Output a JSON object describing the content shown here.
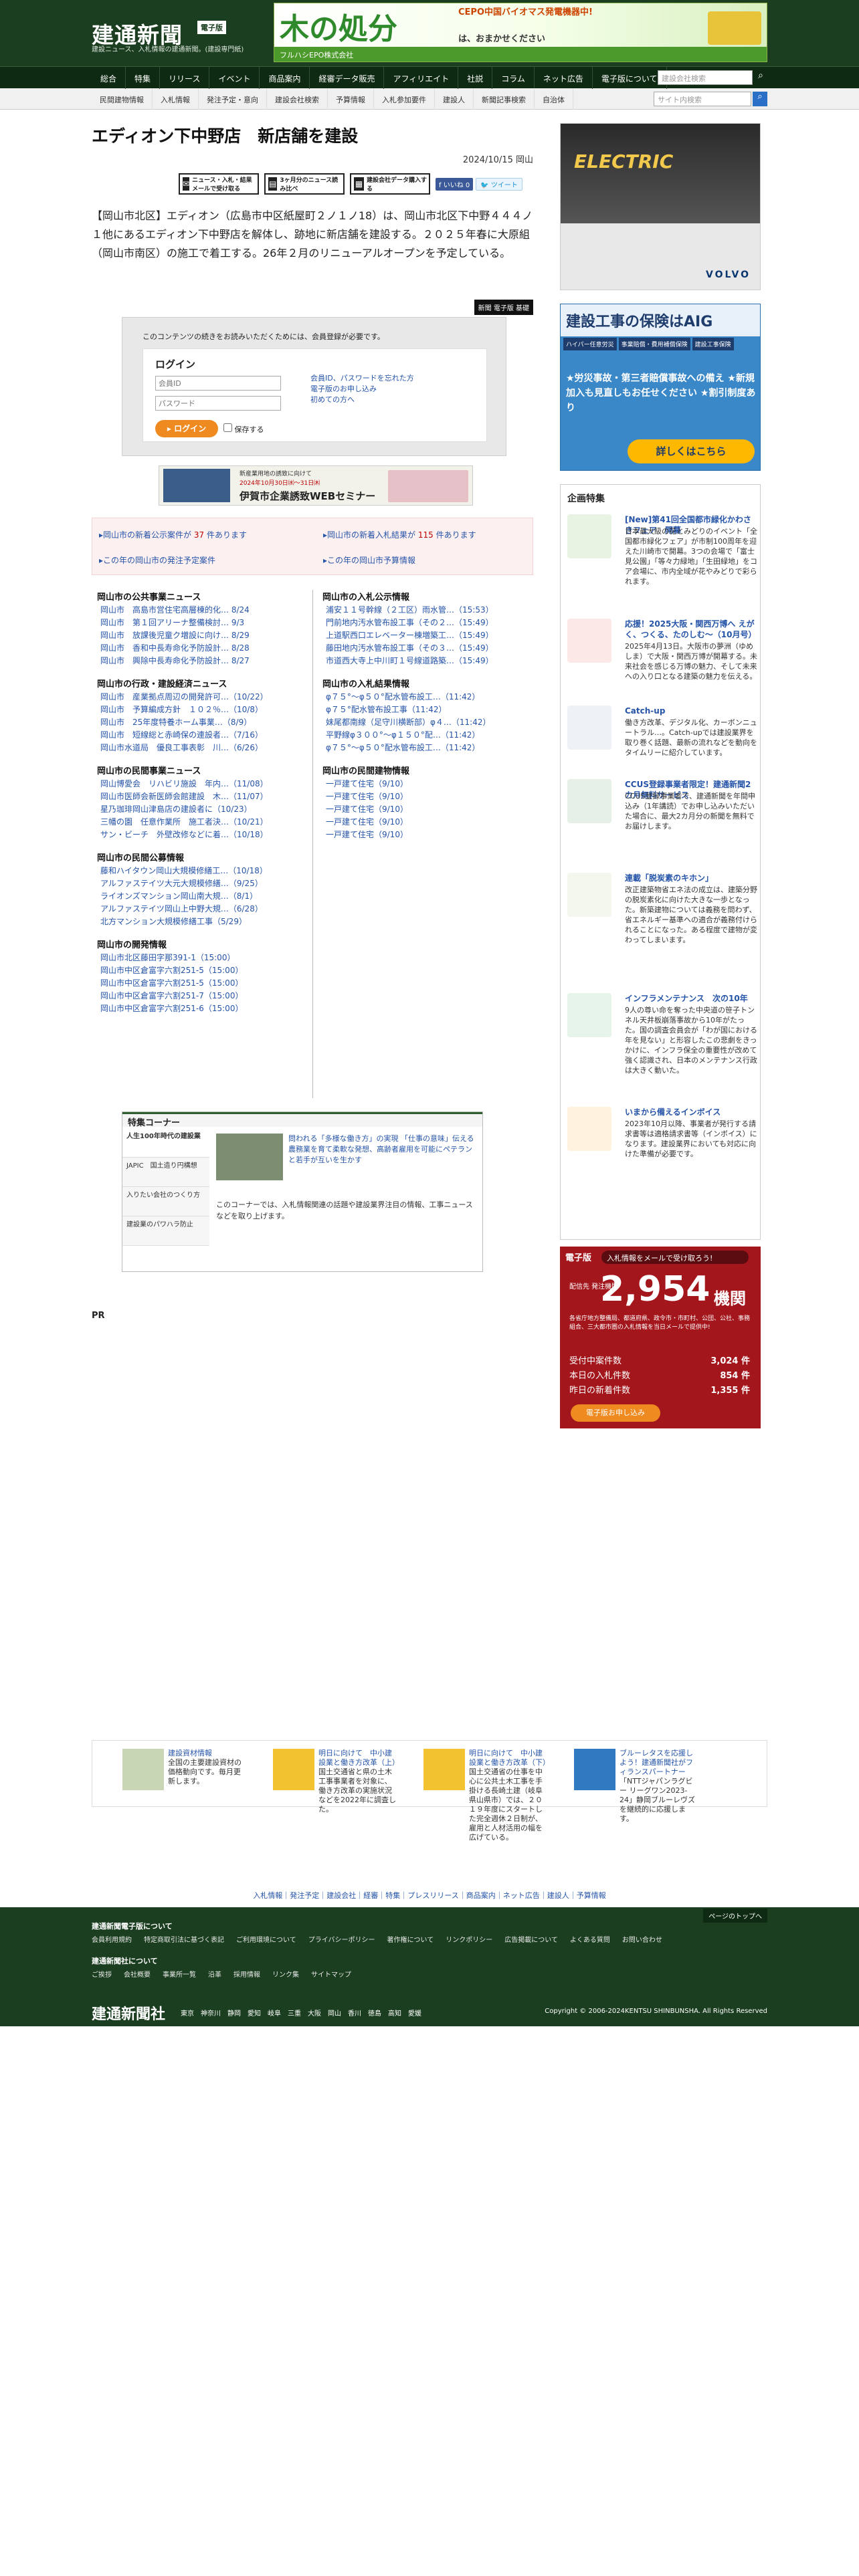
{
  "header": {
    "logo": "建通新聞",
    "edition": "電子版",
    "tagline": "建設ニュース、入札情報の建通新聞。(建設専門紙)",
    "banner_big": "木の処分",
    "banner_small": "CEPO中国バイオマス発電機器中!",
    "banner_sub": "は、おまかせください",
    "banner_foot": "フルハシEPO株式会社"
  },
  "nav1": {
    "items": [
      "総合",
      "特集",
      "リリース",
      "イベント",
      "商品案内",
      "経審データ販売",
      "アフィリエイト",
      "社説",
      "コラム",
      "ネット広告",
      "電子版について"
    ],
    "search_placeholder": "建設会社検索"
  },
  "nav2": {
    "items": [
      "民間建物情報",
      "入札情報",
      "発注予定・意向",
      "建設会社検索",
      "予算情報",
      "入札参加要件",
      "建設人",
      "新聞記事検索",
      "自治体"
    ],
    "search_placeholder": "サイト内検索"
  },
  "article": {
    "title": "エディオン下中野店　新店舗を建設",
    "date": "2024/10/15",
    "region": "岡山",
    "tools": [
      "ニュース・入札・結果メールで受け取る",
      "3ヶ月分のニュース読み比べ",
      "建設会社データ購入する"
    ],
    "like_label": "いいね",
    "like_count": "0",
    "tweet_label": "ツイート",
    "body": "【岡山市北区】エディオン（広島市中区紙屋町２ノ１ノ18）は、岡山市北区下中野４４４ノ１他にあるエディオン下中野店を解体し、跡地に新店舗を建設する。２０２５年春に大原組（岡山市南区）の施工で着工する。26年２月のリニューアルオープンを予定している。",
    "badge": "新聞 電子版 基礎"
  },
  "login": {
    "note": "このコンテンツの続きをお読みいただくためには、会員登録が必要です。",
    "heading": "ログイン",
    "id_placeholder": "会員ID",
    "pw_placeholder": "パスワード",
    "links": [
      "会員ID、パスワードを忘れた方",
      "電子版のお申し込み",
      "初めての方へ"
    ],
    "login_button": "ログイン",
    "keep_label": "保存する"
  },
  "seminar": {
    "line1": "新産業用地の誘致に向けて",
    "line2": "2024年10月30日㈬～31日㈭",
    "line3": "伊賀市企業誘致WEBセミナー"
  },
  "pink": {
    "c1_prefix": "岡山市の新着公示案件が ",
    "c1_count": "37",
    "c1_suffix": " 件あります",
    "c2_prefix": "岡山市の新着入札結果が ",
    "c2_count": "115",
    "c2_suffix": " 件あります",
    "c3": "この年の岡山市の発注予定案件",
    "c4": "この年の岡山市予算情報"
  },
  "sections_left": [
    {
      "title": "岡山市の公共事業ニュース",
      "items": [
        "岡山市　高島市営住宅高層棟的化…  8/24",
        "岡山市　第１回アリーナ整備検討…  9/3",
        "岡山市　放課後児童ク増設に向け…  8/29",
        "岡山市　香和中長寿命化予防設計…  8/28",
        "岡山市　興除中長寿命化予防設計…  8/27"
      ]
    },
    {
      "title": "岡山市の行政・建設経済ニュース",
      "items": [
        "岡山市　産業拠点周辺の開発許可…（10/22）",
        "岡山市　予算編成方針　１０２％…（10/8）",
        "岡山市　25年度特養ホーム事業…（8/9）",
        "岡山市　短線総と赤崎保の連設者…（7/16）",
        "岡山市水道局　優良工事表彰　川…（6/26）"
      ]
    },
    {
      "title": "岡山市の民間事業ニュース",
      "items": [
        "岡山博愛会　リハビリ施設　年内…（11/08）",
        "岡山市医師会新医師会館建設　木…（11/07）",
        "星乃珈琲岡山津島店の建設者に（10/23）",
        "三幡の園　任意作業所　施工者決…（10/21）",
        "サン・ビーチ　外壁改修などに着…（10/18）"
      ]
    },
    {
      "title": "岡山市の民間公募情報",
      "items": [
        "藤和ハイタウン岡山大規模修繕工…（10/18）",
        "アルファステイツ大元大規模修繕…（9/25）",
        "ライオンズマンション岡山南大規…（8/1）",
        "アルファステイツ岡山上中野大規…（6/28）",
        "北方マンション大規模修繕工事（5/29）"
      ]
    },
    {
      "title": "岡山市の開発情報",
      "items": [
        "岡山市北区藤田字那391-1（15:00）",
        "岡山市中区倉富字六割251-5（15:00）",
        "岡山市中区倉富字六割251-5（15:00）",
        "岡山市中区倉富字六割251-7（15:00）",
        "岡山市中区倉富字六割251-6（15:00）"
      ]
    }
  ],
  "sections_right": [
    {
      "title": "岡山市の入札公示情報",
      "items": [
        "浦安１１号幹線（２工区）雨水管…（15:53）",
        "門前地内汚水管布設工事（その２…（15:49）",
        "上道駅西口エレベーター棟増築工…（15:49）",
        "藤田地内汚水管布設工事（その３…（15:49）",
        "市道西大寺上中川町１号線道路築…（15:49）"
      ]
    },
    {
      "title": "岡山市の入札結果情報",
      "items": [
        "φ７５°～φ５０°配水管布設工…（11:42）",
        "φ７５°配水管布設工事（11:42）",
        "妹尾都南線（足守川横断部）φ４…（11:42）",
        "平野線φ３００°～φ１５０°配…（11:42）",
        "φ７５°～φ５０°配水管布設工…（11:42）"
      ]
    },
    {
      "title": "岡山市の民間建物情報",
      "items": [
        "一戸建て住宅（9/10）",
        "一戸建て住宅（9/10）",
        "一戸建て住宅（9/10）",
        "一戸建て住宅（9/10）",
        "一戸建て住宅（9/10）"
      ]
    }
  ],
  "feature": {
    "heading": "特集コーナー",
    "menu": [
      "人生100年時代の建設業",
      "JAPIC　国土造り円構想",
      "入りたい会社のつくり方",
      "建設業のパワハラ防止"
    ],
    "pic_text": "問われる「多様な働き方」の実現 「仕事の意味」伝える農務業を育て柔軟な発想、高齢者雇用を可能にペテランと若手が互いを生かす",
    "desc": "このコーナーでは、入札情報関連の話題や建設業界注目の情報、工事ニュースなどを取り上げます。"
  },
  "pr_label": "PR",
  "side": {
    "ad1_text": "ELECTRIC",
    "ad1_brand": "VOLVO",
    "ad2_top": "建設工事の保険はAIG",
    "ad2_tabs": [
      "ハイパー任意労災",
      "事業賠償・費用補償保険",
      "建設工事保険"
    ],
    "ad2_mid": "★労災事故・第三者賠償事故への備え ★新規加入も見直しもお任せください ★割引制度あり",
    "ad2_btn": "詳しくはこちら",
    "kikaku_heading": "企画特集",
    "kikaku": [
      {
        "title": "[New]第41回全国都市緑化かわさきフェア　開幕",
        "desc": "日本最大級の花とみどりのイベント「全国都市緑化フェア」が市制100周年を迎えた川崎市で開幕。3つの会場で「富士見公園」「等々力緑地」「生田緑地」をコア会場に、市内全域が花やみどりで彩られます。"
      },
      {
        "title": "応援！2025大阪・関西万博へ えがく、つくる、たのしむ～（10月号）",
        "desc": "2025年4月13日。大阪市の夢洲（ゆめしま）で大阪・関西万博が開幕する。未来社会を感じる万博の魅力、そして未来への入り口となる建築の魅力を伝える。"
      },
      {
        "title": "Catch-up",
        "desc": "働き方改革、デジタル化、カーボンニュートラル…。Catch-upでは建設業界を取り巻く話題、最新の流れなどを動向をタイムリーに紹介しています。"
      },
      {
        "title": "CCUS登録事業者限定！建通新聞2カ月無料サービス",
        "desc": "CCUS登録事業者で、建通新聞を年間申込み（1年講読）でお申し込みいただいた場合に、最大2カ月分の新聞を無料でお届けします。"
      },
      {
        "title": "連載「脱炭素のキホン」",
        "desc": "改正建築物省エネ法の成立は、建築分野の脱炭素化に向けた大きな一歩となった。新築建物については義務を問わず、省エネルギー基準への適合が義務付けられることになった。ある程度で建物が変わってしまいます。"
      },
      {
        "title": "インフラメンテナンス　次の10年",
        "desc": "9人の尊い命を奪った中央道の笹子トンネル天井板崩落事故から10年がたった。国の調査会員会が「わが国における年を見ない」と形容したこの悲劇をきっかけに、インフラ保全の重要性が改めて強く認識され、日本のメンテナンス行政は大きく動いた。"
      },
      {
        "title": "いまから備えるインボイス",
        "desc": "2023年10月以降、事業者が発行する請求書等は適格請求書等（インボイス）になります。建設業界においても対応に向けた準備が必要です。"
      }
    ],
    "epaper_label": "電子版",
    "epaper_pill": "入札情報をメールで受け取ろう!",
    "epaper_big": "2,954",
    "epaper_unit": "機関",
    "epaper_lbl": "配信先 発注機関",
    "epaper_sm": "各省庁地方整備局、都道府県、政令市・市町村、公団、公社、事務組合、三大都市圏の入札情報を当日メールで提供中!",
    "stats": [
      {
        "label": "受付中案件数",
        "value": "3,024 件"
      },
      {
        "label": "本日の入札件数",
        "value": "854 件"
      },
      {
        "label": "昨日の新着件数",
        "value": "1,355 件"
      }
    ],
    "epaper_cta": "電子版お申し込み"
  },
  "bottom": [
    {
      "title": "建設資材情報",
      "desc": "全国の主要建設資材の価格動向です。毎月更新します。"
    },
    {
      "title": "明日に向けて　中小建設業と働き方改革（上）",
      "desc": "国土交通省と県の土木工事事業者を対象に、働き方改革の実施状況などを2022年に調査した。"
    },
    {
      "title": "明日に向けて　中小建設業と働き方改革（下）",
      "desc": "国土交通省の仕事を中心に公共土木工事を手掛ける長崎土建（岐阜県山県市）では、２０１９年度にスタートした完全週休２日制が、雇用と人材活用の幅を広げている。"
    },
    {
      "title": "ブルーレタスを応援しよう！建通新聞社がフィランスパートナー",
      "desc": "「NTTジャパンラグビー リーグワン2023-24」静岡ブルーレヴズを継続的に応援します。"
    }
  ],
  "footlinks": "入札情報｜発注予定｜建設会社｜経審｜特集｜プレスリリース｜商品案内｜ネット広告｜建設人｜予算情報",
  "footer": {
    "top_button": "ページのトップへ",
    "h1": "建通新聞電子版について",
    "row1": [
      "会員利用規約",
      "特定商取引法に基づく表記",
      "ご利用環境について",
      "プライバシーポリシー",
      "著作権について",
      "リンクポリシー",
      "広告掲載について",
      "よくある質問",
      "お問い合わせ"
    ],
    "h2": "建通新聞社について",
    "row2": [
      "ご挨拶",
      "会社概要",
      "事業所一覧",
      "沿革",
      "採用情報",
      "リンク集",
      "サイトマップ"
    ],
    "logo": "建通新聞社",
    "cities": [
      "東京",
      "神奈川",
      "静岡",
      "愛知",
      "岐阜",
      "三重",
      "大阪",
      "岡山",
      "香川",
      "徳島",
      "高知",
      "愛媛"
    ],
    "copyright": "Copyright © 2006-2024KENTSU SHINBUNSHA. All Rights Reserved"
  }
}
